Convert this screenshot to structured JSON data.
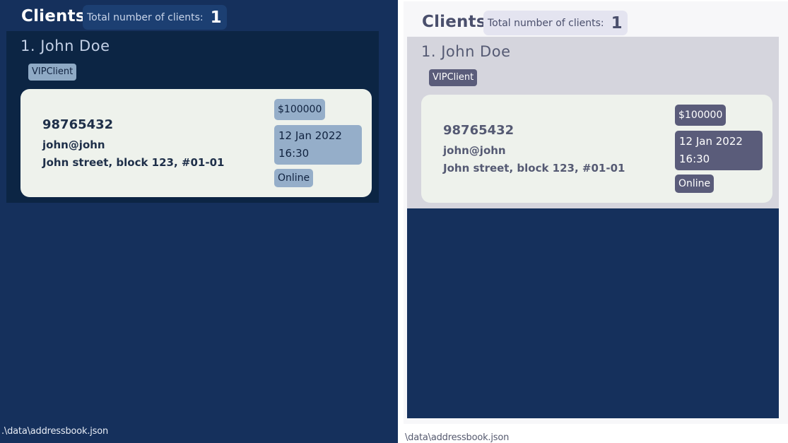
{
  "panels": [
    {
      "theme": "dark",
      "header": {
        "title": "Clients",
        "count_label": "Total number of clients:",
        "count_value": "1"
      },
      "client": {
        "index_name": "1.  John Doe",
        "tag": "VIPClient",
        "phone": "98765432",
        "email": "john@john",
        "address": "John street, block 123, #01-01",
        "price": "$100000",
        "date_line1": "12 Jan 2022",
        "date_line2": "16:30",
        "status": "Online"
      },
      "footer_path": ".\\data\\addressbook.json"
    },
    {
      "theme": "light",
      "header": {
        "title": "Clients",
        "count_label": "Total number of clients:",
        "count_value": "1"
      },
      "client": {
        "index_name": "1.  John Doe",
        "tag": "VIPClient",
        "phone": "98765432",
        "email": "john@john",
        "address": "John street, block 123, #01-01",
        "price": "$100000",
        "date_line1": "12 Jan 2022",
        "date_line2": "16:30",
        "status": "Online"
      },
      "footer_path": "\\data\\addressbook.json"
    }
  ],
  "colors": {
    "dark_background": "#15305c",
    "dark_card": "#0c2544",
    "light_card": "#d5d5dd",
    "detail_card": "#eef2ec",
    "dark_pill": "#95aec9",
    "light_pill": "#5a5c7a"
  }
}
